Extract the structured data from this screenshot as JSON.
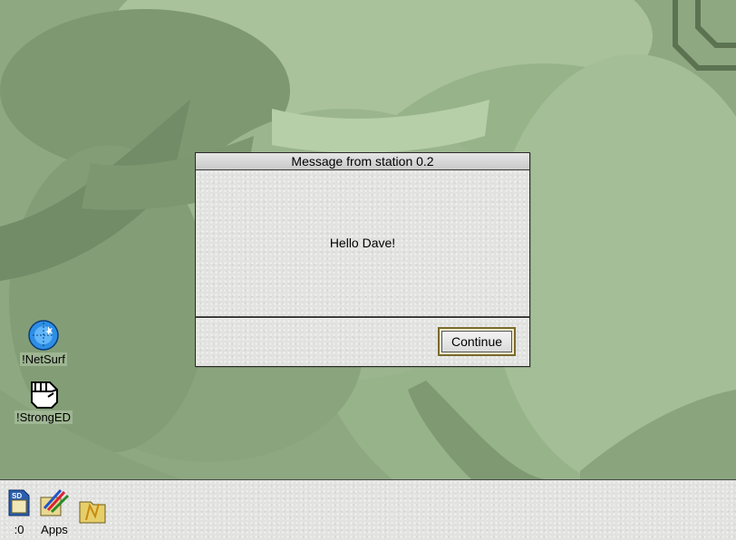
{
  "dialog": {
    "title": "Message from station 0.2",
    "message": "Hello Dave!",
    "continue_label": "Continue"
  },
  "desktop_icons": [
    {
      "label": "!NetSurf",
      "icon": "netsurf-globe-icon"
    },
    {
      "label": "!StrongED",
      "icon": "stronged-fist-icon"
    }
  ],
  "iconbar": {
    "items": [
      {
        "label": ":0",
        "icon": "sd-card-drive-icon"
      },
      {
        "label": "Apps",
        "icon": "apps-paint-icon"
      },
      {
        "label": "",
        "icon": "network-folder-icon"
      }
    ]
  },
  "colors": {
    "desktop_background": "#8ea882",
    "dialog_background": "#e2e2e0",
    "button_highlight": "#7a6a2a"
  }
}
